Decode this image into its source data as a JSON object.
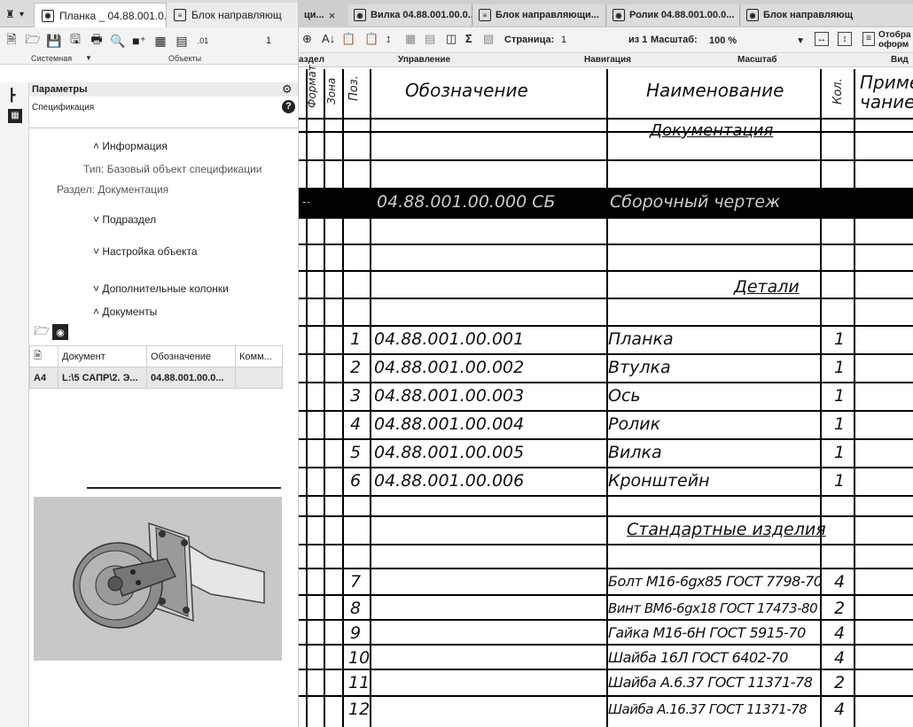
{
  "left_tabs": {
    "tab1": "Планка _ 04.88.001.0...",
    "tab2": "Блок направляющ"
  },
  "left_toolbar": {
    "group1": "Системная",
    "group2": "Объекты",
    "ruler_num": "1"
  },
  "panel": {
    "title": "Параметры",
    "subtitle": "Спецификация",
    "info_header": "Информация",
    "type_line": "Тип: Базовый объект спецификации",
    "section_line": "Раздел: Документация",
    "subsection": "Подраздел",
    "object_settings": "Настройка объекта",
    "extra_columns": "Дополнительные колонки",
    "documents": "Документы"
  },
  "doc_table": {
    "headers": [
      "Документ",
      "Обозначение",
      "Комм..."
    ],
    "row": {
      "format": "A4",
      "document": "L:\\5 САПР\\2. Э...",
      "designation": "04.88.001.00.0..."
    }
  },
  "right_tabs": [
    "ци...",
    "Вилка 04.88.001.00.0...",
    "Блок направляющи...",
    "Ролик 04.88.001.00.0...",
    "Блок направляющ"
  ],
  "right_toolbar": {
    "page_label": "Страница:",
    "page_value": "1",
    "of_label": "из 1",
    "scale_label": "Масштаб:",
    "scale_value": "100 %",
    "display_label": "Отобра\nоформ",
    "groups": [
      "аздел",
      "Управление",
      "Навигация",
      "Масштаб",
      "Вид"
    ]
  },
  "spec": {
    "col_headers": {
      "format": "Формат",
      "zone": "Зона",
      "pos": "Поз.",
      "designation": "Обозначение",
      "name": "Наименование",
      "qty": "Кол.",
      "note": "Приме-\nчание"
    },
    "section_docs": "Документация",
    "assembly": {
      "designation": "04.88.001.00.000 СБ",
      "name": "Сборочный чертеж"
    },
    "section_details": "Детали",
    "details": [
      {
        "pos": "1",
        "designation": "04.88.001.00.001",
        "name": "Планка",
        "qty": "1"
      },
      {
        "pos": "2",
        "designation": "04.88.001.00.002",
        "name": "Втулка",
        "qty": "1"
      },
      {
        "pos": "3",
        "designation": "04.88.001.00.003",
        "name": "Ось",
        "qty": "1"
      },
      {
        "pos": "4",
        "designation": "04.88.001.00.004",
        "name": "Ролик",
        "qty": "1"
      },
      {
        "pos": "5",
        "designation": "04.88.001.00.005",
        "name": "Вилка",
        "qty": "1"
      },
      {
        "pos": "6",
        "designation": "04.88.001.00.006",
        "name": "Кронштейн",
        "qty": "1"
      }
    ],
    "section_standard": "Стандартные изделия",
    "standard": [
      {
        "pos": "7",
        "name": "Болт М16-6gх85 ГОСТ 7798-70",
        "qty": "4"
      },
      {
        "pos": "8",
        "name": "Винт ВМ6-6gх18 ГОСТ 17473-80",
        "qty": "2"
      },
      {
        "pos": "9",
        "name": "Гайка М16-6Н ГОСТ 5915-70",
        "qty": "4"
      },
      {
        "pos": "10",
        "name": "Шайба 16Л ГОСТ 6402-70",
        "qty": "4"
      },
      {
        "pos": "11",
        "name": "Шайба А.6.37 ГОСТ 11371-78",
        "qty": "2"
      },
      {
        "pos": "12",
        "name": "Шайба А.16.37 ГОСТ 11371-78",
        "qty": "4"
      }
    ]
  }
}
